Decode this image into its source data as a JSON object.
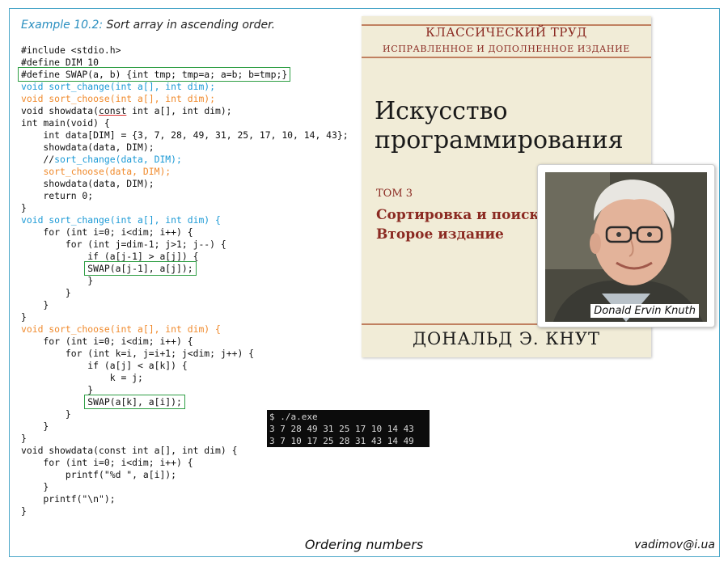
{
  "example": {
    "label": "Example 10.2:",
    "title": "Sort array in ascending order."
  },
  "code": {
    "l1": "#include <stdio.h>",
    "l2": "#define DIM 10",
    "l3": "#define SWAP(a, b) {int tmp; tmp=a; a=b; b=tmp;}",
    "l4": "void sort_change(int a[], int dim);",
    "l5": "void sort_choose(int a[], int dim);",
    "l6a": "void showdata(",
    "l6b": "const",
    "l6c": " int a[], int dim);",
    "l7": "int main(void) {",
    "l8": "    int data[DIM] = {3, 7, 28, 49, 31, 25, 17, 10, 14, 43};",
    "l9": "    showdata(data, DIM);",
    "l10a": "    //",
    "l10b": "sort_change(data, DIM);",
    "l11a": "    ",
    "l11b": "sort_choose(data, DIM);",
    "l12": "    showdata(data, DIM);",
    "l13": "    return 0;",
    "l14": "}",
    "l15": "void sort_change(int a[], int dim) {",
    "l16": "    for (int i=0; i<dim; i++) {",
    "l17": "        for (int j=dim-1; j>1; j--) {",
    "l18": "            if (a[j-1] > a[j]) {",
    "l19a": "            ",
    "l19b": "SWAP(a[j-1], a[j]);",
    "l20": "            }",
    "l21": "        }",
    "l22": "    }",
    "l23": "}",
    "l24": "void sort_choose(int a[], int dim) {",
    "l25": "    for (int i=0; i<dim; i++) {",
    "l26": "        for (int k=i, j=i+1; j<dim; j++) {",
    "l27": "            if (a[j] < a[k]) {",
    "l28": "                k = j;",
    "l29": "            }",
    "l30a": "            ",
    "l30b": "SWAP(a[k], a[i]);",
    "l31": "        }",
    "l32": "    }",
    "l33": "}",
    "l34": "void showdata(const int a[], int dim) {",
    "l35": "    for (int i=0; i<dim; i++) {",
    "l36": "        printf(\"%d \", a[i]);",
    "l37": "    }",
    "l38": "    printf(\"\\n\");",
    "l39": "}"
  },
  "console": {
    "prompt": "$ ./a.exe",
    "before": "3 7 28 49 31 25 17 10 14 43",
    "after": "3 7 10 17 25 28 31 43 14 49"
  },
  "book": {
    "series": "КЛАССИЧЕСКИЙ ТРУД",
    "edition_note": "ИСПРАВЛЕННОЕ И ДОПОЛНЕННОЕ ИЗДАНИЕ",
    "title_line1": "Искусство",
    "title_line2": "программирования",
    "volume": "ТОМ 3",
    "subtitle_line1": "Сортировка и поиск",
    "subtitle_line2": "Второе издание",
    "author": "ДОНАЛЬД Э. КНУТ"
  },
  "photo": {
    "caption": "Donald Ervin Knuth"
  },
  "footer": {
    "title": "Ordering numbers",
    "email": "vadimov@i.ua"
  },
  "colors": {
    "frame": "#4aa6c8",
    "code_blue": "#1c9ad6",
    "code_orange": "#f08a2c",
    "box_green": "#2f9e44",
    "book_red": "#8b2a22"
  }
}
